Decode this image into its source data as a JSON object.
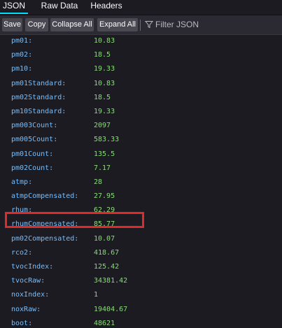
{
  "tabs": [
    {
      "label": "JSON"
    },
    {
      "label": "Raw Data"
    },
    {
      "label": "Headers"
    }
  ],
  "toolbar": {
    "save_label": "Save",
    "copy_label": "Copy",
    "collapse_label": "Collapse All",
    "expand_label": "Expand All",
    "filter_placeholder": "Filter JSON",
    "filter_icon": "funnel-icon"
  },
  "colors": {
    "key": "#75bfff",
    "value": "#86de74",
    "highlight": "#e02a2a",
    "selected_tab": "#00ddff"
  },
  "rows": [
    {
      "key": "pm01:",
      "value": "10.83"
    },
    {
      "key": "pm02:",
      "value": "18.5"
    },
    {
      "key": "pm10:",
      "value": "19.33"
    },
    {
      "key": "pm01Standard:",
      "value": "10.83"
    },
    {
      "key": "pm02Standard:",
      "value": "18.5"
    },
    {
      "key": "pm10Standard:",
      "value": "19.33"
    },
    {
      "key": "pm003Count:",
      "value": "2097"
    },
    {
      "key": "pm005Count:",
      "value": "583.33"
    },
    {
      "key": "pm01Count:",
      "value": "135.5"
    },
    {
      "key": "pm02Count:",
      "value": "7.17"
    },
    {
      "key": "atmp:",
      "value": "28"
    },
    {
      "key": "atmpCompensated:",
      "value": "27.95"
    },
    {
      "key": "rhum:",
      "value": "62.29"
    },
    {
      "key": "rhumCompensated:",
      "value": "85.77"
    },
    {
      "key": "pm02Compensated:",
      "value": "10.07"
    },
    {
      "key": "rco2:",
      "value": "418.67"
    },
    {
      "key": "tvocIndex:",
      "value": "125.42"
    },
    {
      "key": "tvocRaw:",
      "value": "34381.42"
    },
    {
      "key": "noxIndex:",
      "value": "1"
    },
    {
      "key": "noxRaw:",
      "value": "19404.67"
    },
    {
      "key": "boot:",
      "value": "48621"
    }
  ]
}
